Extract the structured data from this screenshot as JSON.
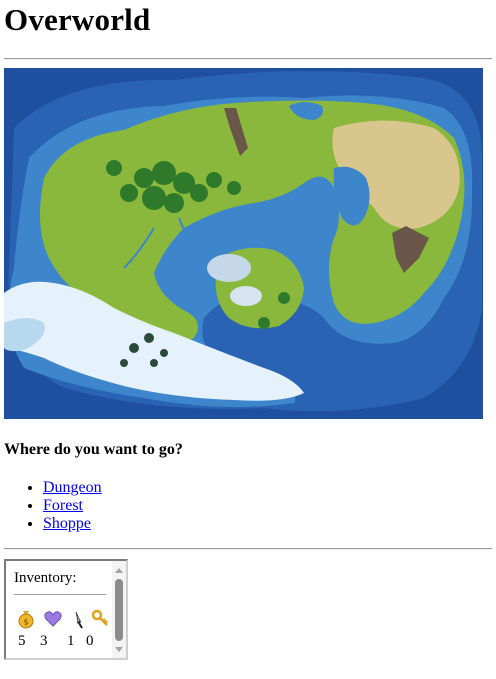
{
  "page": {
    "title": "Overworld"
  },
  "prompt": "Where do you want to go?",
  "destinations": [
    {
      "label": "Dungeon"
    },
    {
      "label": "Forest"
    },
    {
      "label": "Shoppe"
    }
  ],
  "inventory": {
    "title": "Inventory:",
    "items": [
      {
        "icon": "money-bag-icon",
        "count": "5",
        "color": "#e0a21a"
      },
      {
        "icon": "heart-icon",
        "count": "3",
        "color": "#8c6ad8"
      },
      {
        "icon": "dagger-icon",
        "count": "1",
        "color": "#222222"
      },
      {
        "icon": "key-icon",
        "count": "0",
        "color": "#e0a21a"
      }
    ]
  },
  "colors": {
    "link": "#0000ee",
    "deep_water": "#1f4f9f",
    "shallow_water": "#3d86cc",
    "grass": "#8ab83c",
    "sand": "#d8c68c",
    "snow": "#e6f2fb"
  }
}
